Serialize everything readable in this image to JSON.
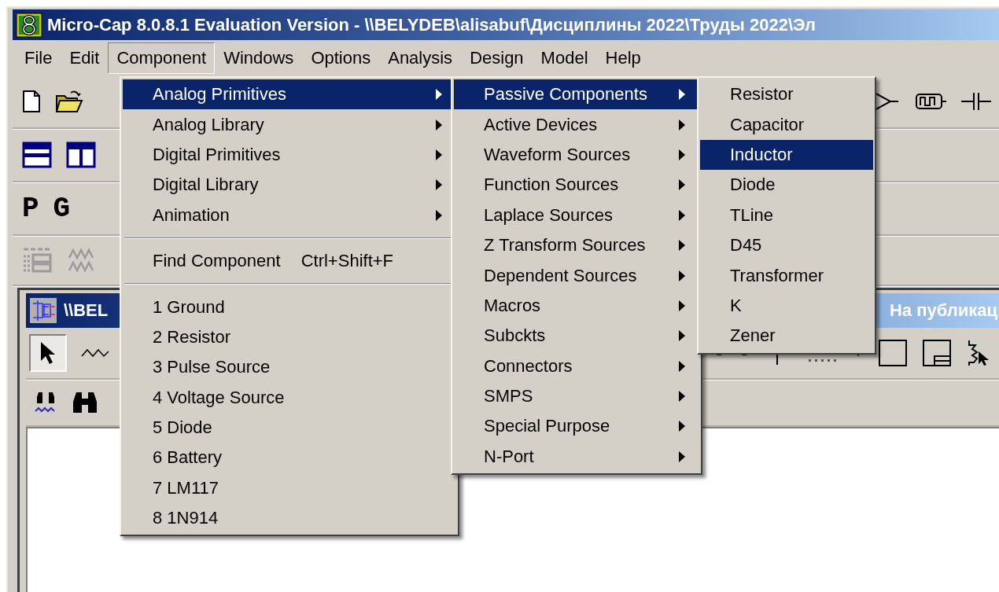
{
  "window": {
    "title": "Micro-Cap 8.0.8.1 Evaluation Version - \\\\BELYDEB\\alisabuf\\Дисциплины 2022\\Труды 2022\\Эл"
  },
  "menu_bar": [
    {
      "label": "File",
      "selected": false
    },
    {
      "label": "Edit",
      "selected": false
    },
    {
      "label": "Component",
      "selected": true
    },
    {
      "label": "Windows",
      "selected": false
    },
    {
      "label": "Options",
      "selected": false
    },
    {
      "label": "Analysis",
      "selected": false
    },
    {
      "label": "Design",
      "selected": false
    },
    {
      "label": "Model",
      "selected": false
    },
    {
      "label": "Help",
      "selected": false
    }
  ],
  "toolbar_letters": [
    "P",
    "G"
  ],
  "child_window": {
    "title_left": "\\\\BEL",
    "title_right": "На публикац"
  },
  "component_menu": [
    {
      "kind": "item",
      "label": "Analog Primitives",
      "submenu": true,
      "selected": true
    },
    {
      "kind": "item",
      "label": "Analog Library",
      "submenu": true,
      "selected": false
    },
    {
      "kind": "item",
      "label": "Digital Primitives",
      "submenu": true,
      "selected": false
    },
    {
      "kind": "item",
      "label": "Digital Library",
      "submenu": true,
      "selected": false
    },
    {
      "kind": "item",
      "label": "Animation",
      "submenu": true,
      "selected": false
    },
    {
      "kind": "separator"
    },
    {
      "kind": "item",
      "label": "Find Component",
      "shortcut": "Ctrl+Shift+F",
      "submenu": false,
      "selected": false
    },
    {
      "kind": "separator"
    },
    {
      "kind": "item",
      "label": "1 Ground",
      "submenu": false,
      "selected": false
    },
    {
      "kind": "item",
      "label": "2 Resistor",
      "submenu": false,
      "selected": false
    },
    {
      "kind": "item",
      "label": "3 Pulse Source",
      "submenu": false,
      "selected": false
    },
    {
      "kind": "item",
      "label": "4 Voltage Source",
      "submenu": false,
      "selected": false
    },
    {
      "kind": "item",
      "label": "5 Diode",
      "submenu": false,
      "selected": false
    },
    {
      "kind": "item",
      "label": "6 Battery",
      "submenu": false,
      "selected": false
    },
    {
      "kind": "item",
      "label": "7 LM117",
      "submenu": false,
      "selected": false
    },
    {
      "kind": "item",
      "label": "8 1N914",
      "submenu": false,
      "selected": false
    }
  ],
  "analog_primitives_menu": [
    {
      "kind": "item",
      "label": "Passive Components",
      "submenu": true,
      "selected": true
    },
    {
      "kind": "item",
      "label": "Active Devices",
      "submenu": true,
      "selected": false
    },
    {
      "kind": "item",
      "label": "Waveform Sources",
      "submenu": true,
      "selected": false
    },
    {
      "kind": "item",
      "label": "Function Sources",
      "submenu": true,
      "selected": false
    },
    {
      "kind": "item",
      "label": "Laplace Sources",
      "submenu": true,
      "selected": false
    },
    {
      "kind": "item",
      "label": "Z Transform Sources",
      "submenu": true,
      "selected": false
    },
    {
      "kind": "item",
      "label": "Dependent Sources",
      "submenu": true,
      "selected": false
    },
    {
      "kind": "item",
      "label": "Macros",
      "submenu": true,
      "selected": false
    },
    {
      "kind": "item",
      "label": "Subckts",
      "submenu": true,
      "selected": false
    },
    {
      "kind": "item",
      "label": "Connectors",
      "submenu": true,
      "selected": false
    },
    {
      "kind": "item",
      "label": "SMPS",
      "submenu": true,
      "selected": false
    },
    {
      "kind": "item",
      "label": "Special Purpose",
      "submenu": true,
      "selected": false
    },
    {
      "kind": "item",
      "label": "N-Port",
      "submenu": true,
      "selected": false
    }
  ],
  "passive_components_menu": [
    {
      "kind": "item",
      "label": "Resistor",
      "submenu": false,
      "selected": false
    },
    {
      "kind": "item",
      "label": "Capacitor",
      "submenu": false,
      "selected": false
    },
    {
      "kind": "item",
      "label": "Inductor",
      "submenu": false,
      "selected": true
    },
    {
      "kind": "item",
      "label": "Diode",
      "submenu": false,
      "selected": false
    },
    {
      "kind": "item",
      "label": "TLine",
      "submenu": false,
      "selected": false
    },
    {
      "kind": "item",
      "label": "D45",
      "submenu": false,
      "selected": false
    },
    {
      "kind": "item",
      "label": "Transformer",
      "submenu": false,
      "selected": false
    },
    {
      "kind": "item",
      "label": "K",
      "submenu": false,
      "selected": false
    },
    {
      "kind": "item",
      "label": "Zener",
      "submenu": false,
      "selected": false
    }
  ]
}
